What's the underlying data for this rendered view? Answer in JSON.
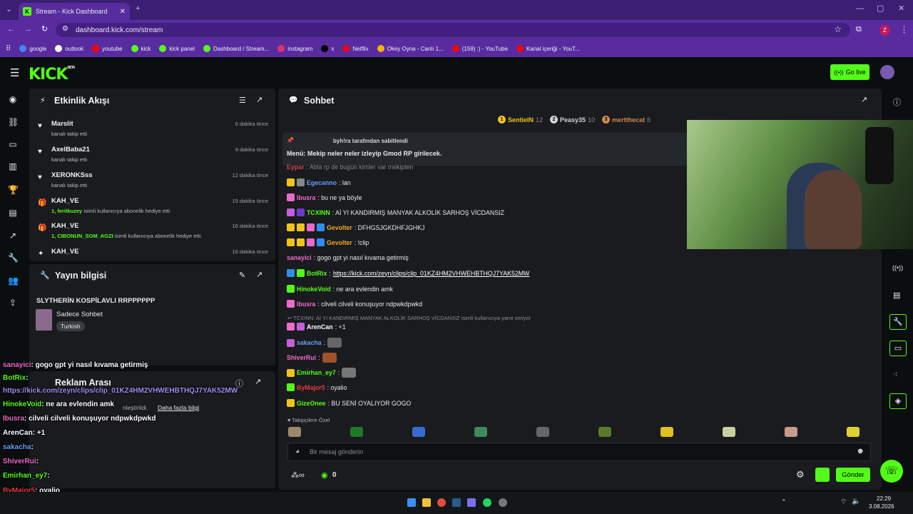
{
  "browser": {
    "tab_title": "Stream - Kick Dashboard",
    "url": "dashboard.kick.com/stream",
    "profile_initial": "Z",
    "bookmarks": [
      {
        "label": "google",
        "color": "#4285f4"
      },
      {
        "label": "outlook",
        "color": "#ffffff"
      },
      {
        "label": "youtube",
        "color": "#ff0000"
      },
      {
        "label": "kick",
        "color": "#53fc18"
      },
      {
        "label": "kick panel",
        "color": "#53fc18"
      },
      {
        "label": "Dashboard / Stream...",
        "color": "#53fc18"
      },
      {
        "label": "instagram",
        "color": "#e1306c"
      },
      {
        "label": "x",
        "color": "#000000"
      },
      {
        "label": "Netflix",
        "color": "#e50914"
      },
      {
        "label": "Okey Oyna - Canlı 1...",
        "color": "#f5b400"
      },
      {
        "label": "(159) :) - YouTube",
        "color": "#ff0000"
      },
      {
        "label": "Kanal içeriği - YouT...",
        "color": "#ff0000"
      }
    ]
  },
  "header": {
    "logo": "KICK",
    "beta": "BETA",
    "go_live_label": "Go live"
  },
  "activity": {
    "title": "Etkinlik Akışı",
    "items": [
      {
        "name": "Marslit",
        "sub": "kanalı takip etti",
        "time": "6 dakika önce",
        "type": "follow"
      },
      {
        "name": "AxelBaba21",
        "sub": "kanalı takip etti",
        "time": "9 dakika önce",
        "type": "follow"
      },
      {
        "name": "XERONKSss",
        "sub": "kanalı takip etti",
        "time": "12 dakika önce",
        "type": "follow"
      },
      {
        "name": "KAH_VE",
        "sub_user": "1, feritkuzey",
        "sub": " isimli kullanıcıya abonelik hediye etti.",
        "time": "15 dakika önce",
        "type": "gift"
      },
      {
        "name": "KAH_VE",
        "sub_user": "1, CIBONUN_SOM_AGZI",
        "sub": " isimli kullanıcıya abonelik hediye etti.",
        "time": "16 dakika önce",
        "type": "gift"
      },
      {
        "name": "KAH_VE",
        "sub": "",
        "time": "16 dakika önce",
        "type": "other"
      }
    ]
  },
  "stream_info": {
    "title": "Yayın bilgisi",
    "stream_title": "SLYTHERİN KOSPİLAVLI RRPPPPPP",
    "category": "Sadece Sohbet",
    "language": "Turkish"
  },
  "ad_break": {
    "title": "Reklam Arası",
    "partial_text": "nleştirildi.",
    "link": "Daha fazla bilgi"
  },
  "chat": {
    "title": "Sohbet",
    "top_gifters": [
      {
        "rank": "1",
        "name": "SentieIN",
        "count": "12",
        "color": "#f0c419"
      },
      {
        "rank": "2",
        "name": "Peasy35",
        "count": "10",
        "color": "#cfd3d6"
      },
      {
        "rank": "3",
        "name": "mertthecat",
        "count": "6",
        "color": "#d08a4e"
      }
    ],
    "pinned_by": "byh!ra tarafından sabitlendi",
    "pinned_message": "Menü: Mekip neler neler izleyip Gmod RP girilecek.",
    "partial_line": {
      "user": "Eypar",
      "text": ": Abla rp de bugün kimler var mekipten"
    },
    "messages": [
      {
        "user": "Egecanno",
        "color": "#6b9cf5",
        "text": ": lan"
      },
      {
        "user": "Ibusra",
        "color": "#f06acb",
        "text": ": bu ne ya böyle"
      },
      {
        "user": "TCXINN",
        "color": "#53fc18",
        "text": ": Aİ YI KANDIRMIŞ MANYAK ALKOLİK SARHOŞ VİCDANSIZ"
      },
      {
        "user": "Gevolter",
        "color": "#f5a623",
        "text": ": DFHGSJGKDHFJGHKJ"
      },
      {
        "user": "Gevolter",
        "color": "#f5a623",
        "text": ": !clip"
      },
      {
        "user": "sanayici",
        "color": "#f06acb",
        "text": ": gogo gpt yi nasıl kıvama getirmiş"
      },
      {
        "user": "BotRix",
        "color": "#53fc18",
        "text": ": ",
        "link": "https://kick.com/zeyn/clips/clip_01KZ4HM2VHWEHBTHQJ7YAK52MW"
      },
      {
        "user": "HinokeVoid",
        "color": "#53fc18",
        "text": ": ne ara evlendin amk"
      },
      {
        "user": "Ibusra",
        "color": "#f06acb",
        "text": ": cilveli cilveli konuşuyor ndpwkdpwkd"
      }
    ],
    "reply_to": "TCXINN: Aİ YI KANDIRMIŞ MANYAK ALKOLİK SARHOŞ VİCDANSIZ isimli kullanıcıya yanıt veriyor",
    "messages2": [
      {
        "user": "ArenCan",
        "color": "#ffffff",
        "text": ": +1"
      },
      {
        "user": "sakacha",
        "color": "#6b9cf5",
        "text": ":"
      },
      {
        "user": "ShiverRui",
        "color": "#f06acb",
        "text": ":"
      },
      {
        "user": "Emirhan_ey7",
        "color": "#53fc18",
        "text": ":"
      },
      {
        "user": "ByMajor5",
        "color": "#e83b3b",
        "text": ": oyalio"
      },
      {
        "user": "GizeOnee",
        "color": "#53fc18",
        "text": ": BU SENİ OYALIYOR GOGO"
      }
    ],
    "followers_only_label": "Takipçilere Özel",
    "input_placeholder": "Bir mesaj gönderin",
    "points": "0",
    "send_label": "Gönder"
  },
  "overlay_chat": [
    {
      "user": "sanayici",
      "text": ": gogo gpt yi nasıl kıvama getirmiş",
      "color": "#f06acb"
    },
    {
      "user": "BotRix",
      "text": ":",
      "color": "#53fc18"
    },
    {
      "user": "",
      "text": "https://kick.com/zeyn/clips/clip_01KZ4HM2VHWEHBTHQJ7YAK52MW",
      "color": "#a38cf0"
    },
    {
      "user": "HinokeVoid",
      "text": ": ne ara evlendin amk",
      "color": "#53fc18"
    },
    {
      "user": "Ibusra",
      "text": ": cilveli cilveli konuşuyor ndpwkdpwkd",
      "color": "#f06acb"
    },
    {
      "user": "ArenCan",
      "text": ": +1",
      "color": "#ffffff"
    },
    {
      "user": "sakacha",
      "text": ":",
      "color": "#6b9cf5"
    },
    {
      "user": "ShiverRui",
      "text": ":",
      "color": "#f06acb"
    },
    {
      "user": "Emirhan_ey7",
      "text": ":",
      "color": "#53fc18"
    },
    {
      "user": "ByMajor5",
      "text": ": oyalio",
      "color": "#e83b3b"
    },
    {
      "user": "GizeOnee",
      "text": ": BU SENİ OYALIYOR GOGO",
      "color": "#ffffff"
    }
  ],
  "taskbar": {
    "time": "22:29",
    "date": "3.08.2026"
  }
}
